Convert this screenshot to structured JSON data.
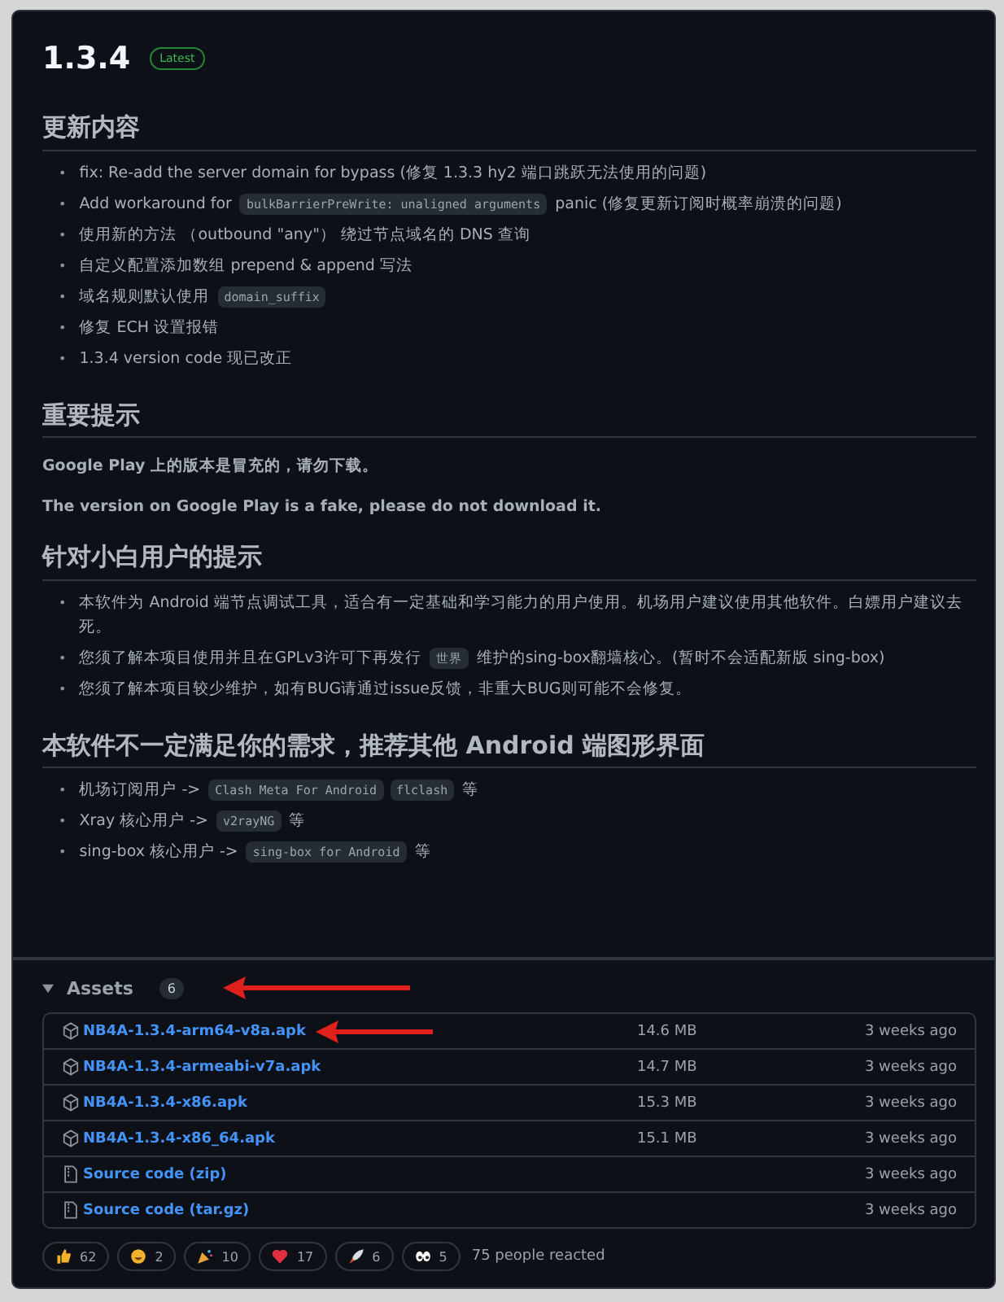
{
  "release": {
    "title": "1.3.4",
    "badge": "Latest"
  },
  "sections": [
    {
      "heading": "更新内容",
      "kind": "list",
      "bullet": "•",
      "items": [
        [
          {
            "kind": "text",
            "text": "fix: Re-add the server domain for bypass (修复 1.3.3 hy2 端口跳跃无法使用的问题)"
          }
        ],
        [
          {
            "kind": "text",
            "text": "Add workaround for "
          },
          {
            "kind": "code",
            "text": "bulkBarrierPreWrite: unaligned arguments"
          },
          {
            "kind": "text",
            "text": " panic (修复更新订阅时概率崩溃的问题)"
          }
        ],
        [
          {
            "kind": "text",
            "text": "使用新的方法 （outbound \"any\"） 绕过节点域名的 DNS 查询"
          }
        ],
        [
          {
            "kind": "text",
            "text": "自定义配置添加数组 prepend & append 写法"
          }
        ],
        [
          {
            "kind": "text",
            "text": "域名规则默认使用 "
          },
          {
            "kind": "code",
            "text": "domain_suffix"
          }
        ],
        [
          {
            "kind": "text",
            "text": "修复 ECH 设置报错"
          }
        ],
        [
          {
            "kind": "text",
            "text": "1.3.4 version code 现已改正"
          }
        ]
      ]
    },
    {
      "heading": "重要提示",
      "kind": "paragraphs",
      "items": [
        [
          {
            "kind": "text",
            "text": "Google Play 上的版本是冒充的，请勿下载。"
          }
        ],
        [
          {
            "kind": "text",
            "text": "The version on Google Play is a fake, please do not download it."
          }
        ]
      ]
    },
    {
      "heading": "针对小白用户的提示",
      "kind": "list",
      "bullet": "•",
      "items": [
        [
          {
            "kind": "text",
            "text": "本软件为 Android 端节点调试工具，适合有一定基础和学习能力的用户使用。机场用户建议使用其他软件。白嫖用户建议去死。"
          }
        ],
        [
          {
            "kind": "text",
            "text": "您须了解本项目使用并且在GPLv3许可下再发行 "
          },
          {
            "kind": "code",
            "text": "世界"
          },
          {
            "kind": "text",
            "text": " 维护的sing-box翻墙核心。(暂时不会适配新版 sing-box)"
          }
        ],
        [
          {
            "kind": "text",
            "text": "您须了解本项目较少维护，如有BUG请通过issue反馈，非重大BUG则可能不会修复。"
          }
        ]
      ]
    },
    {
      "heading": "本软件不一定满足你的需求，推荐其他 Android 端图形界面",
      "kind": "list",
      "bullet": "•",
      "items": [
        [
          {
            "kind": "text",
            "text": "机场订阅用户 -> "
          },
          {
            "kind": "code",
            "text": "Clash Meta For Android"
          },
          {
            "kind": "code",
            "text": "flclash"
          },
          {
            "kind": "text",
            "text": " 等"
          }
        ],
        [
          {
            "kind": "text",
            "text": "Xray 核心用户 -> "
          },
          {
            "kind": "code",
            "text": "v2rayNG"
          },
          {
            "kind": "text",
            "text": " 等"
          }
        ],
        [
          {
            "kind": "text",
            "text": "sing-box 核心用户 -> "
          },
          {
            "kind": "code",
            "text": "sing-box for Android"
          },
          {
            "kind": "text",
            "text": " 等"
          }
        ]
      ]
    }
  ],
  "assets": {
    "title": "Assets",
    "count": "6",
    "expanded": true,
    "files": [
      {
        "kind": "package",
        "name": "NB4A-1.3.4-arm64-v8a.apk",
        "size": "14.6 MB",
        "date": "3 weeks ago",
        "arrow": true
      },
      {
        "kind": "package",
        "name": "NB4A-1.3.4-armeabi-v7a.apk",
        "size": "14.7 MB",
        "date": "3 weeks ago",
        "arrow": false
      },
      {
        "kind": "package",
        "name": "NB4A-1.3.4-x86.apk",
        "size": "15.3 MB",
        "date": "3 weeks ago",
        "arrow": false
      },
      {
        "kind": "package",
        "name": "NB4A-1.3.4-x86_64.apk",
        "size": "15.1 MB",
        "date": "3 weeks ago",
        "arrow": false
      },
      {
        "kind": "source",
        "name": "Source code (zip)",
        "date": "3 weeks ago",
        "arrow": false
      },
      {
        "kind": "source",
        "name": "Source code (tar.gz)",
        "date": "3 weeks ago",
        "arrow": false
      }
    ]
  },
  "reactions": {
    "items": [
      {
        "kind": "thumbs-up",
        "count": "62"
      },
      {
        "kind": "smile",
        "count": "2"
      },
      {
        "kind": "party",
        "count": "10"
      },
      {
        "kind": "heart",
        "count": "17"
      },
      {
        "kind": "rocket",
        "count": "6"
      },
      {
        "kind": "eyes",
        "count": "5"
      }
    ],
    "summary": "75 people reacted"
  }
}
